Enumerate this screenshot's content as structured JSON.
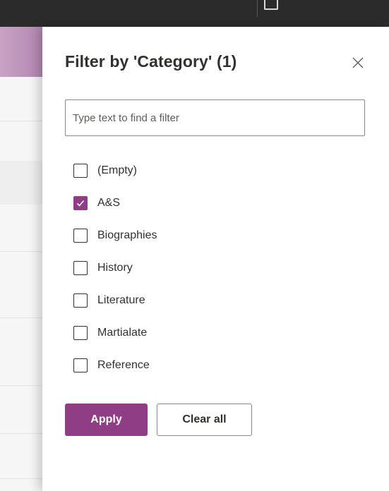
{
  "panel": {
    "title": "Filter by 'Category' (1)",
    "close_icon": "close-icon",
    "search": {
      "placeholder": "Type text to find a filter",
      "value": ""
    },
    "options": [
      {
        "label": "(Empty)",
        "checked": false
      },
      {
        "label": "A&S",
        "checked": true
      },
      {
        "label": "Biographies",
        "checked": false
      },
      {
        "label": "History",
        "checked": false
      },
      {
        "label": "Literature",
        "checked": false
      },
      {
        "label": "Martialate",
        "checked": false
      },
      {
        "label": "Reference",
        "checked": false
      }
    ],
    "apply_label": "Apply",
    "clear_label": "Clear all"
  },
  "colors": {
    "accent": "#8f3e86",
    "text": "#323130",
    "border": "#8a8886",
    "topbar": "#2b2b2b"
  }
}
